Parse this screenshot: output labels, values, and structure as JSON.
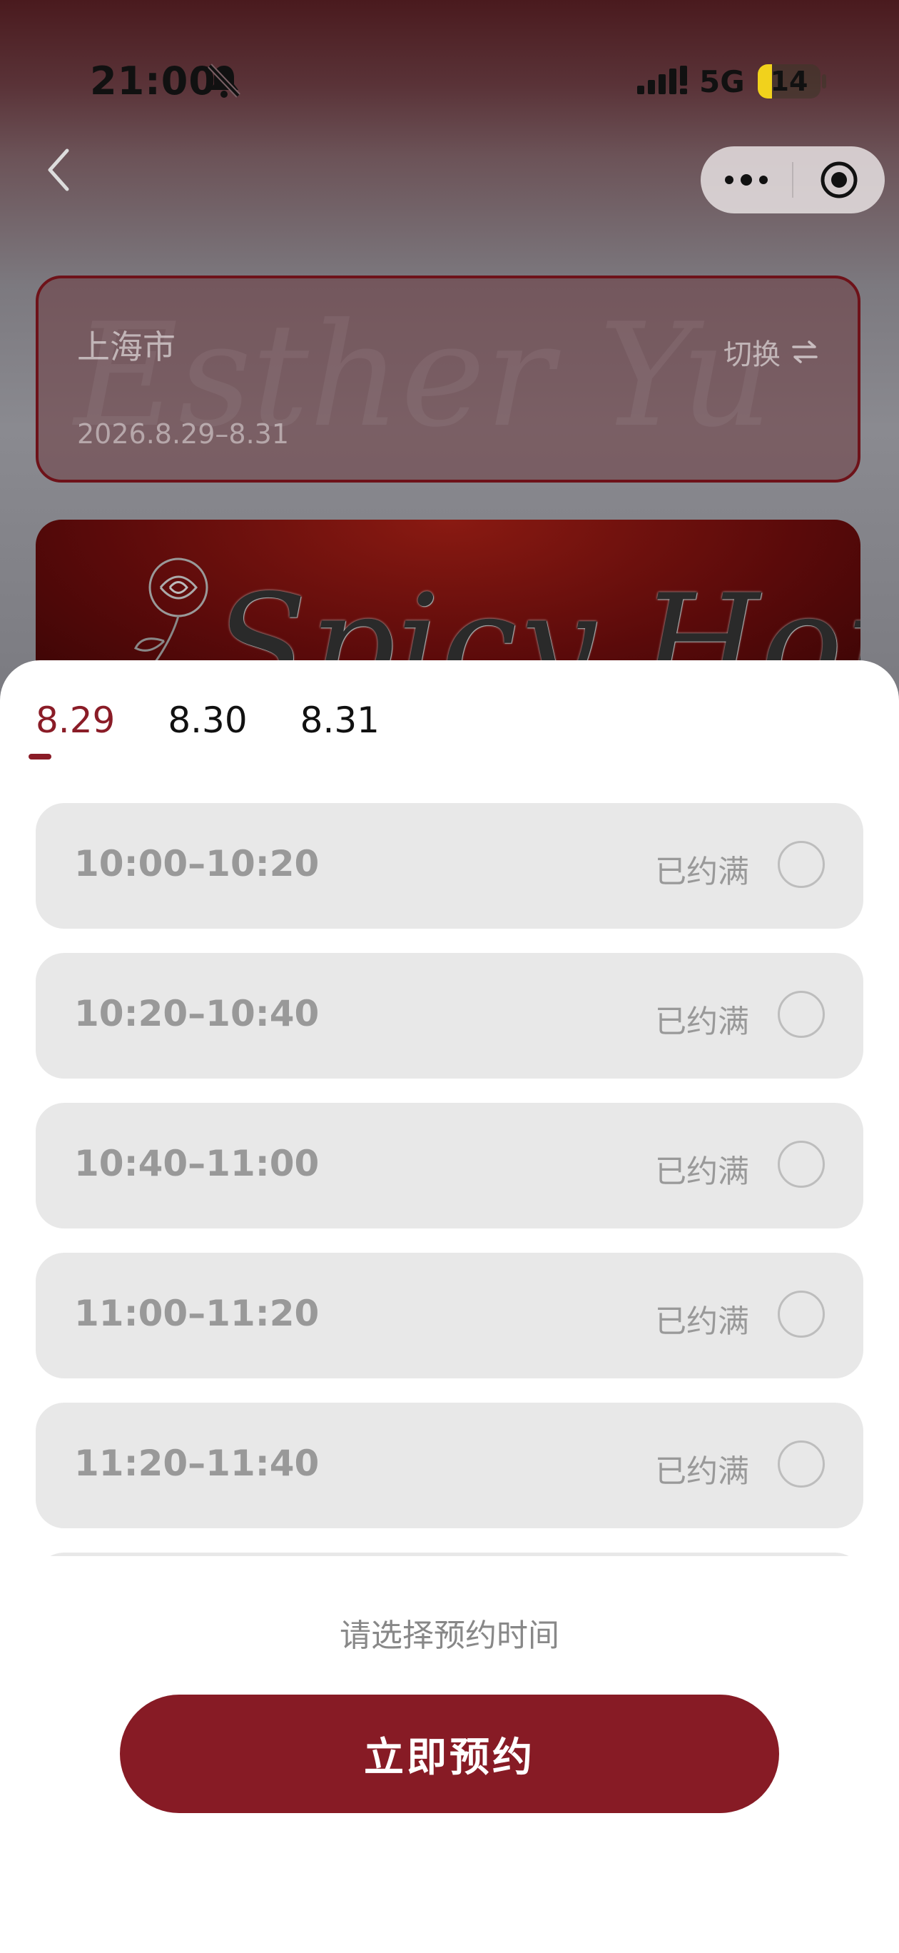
{
  "status_bar": {
    "time": "21:00",
    "network": "5G",
    "battery": "14"
  },
  "city_card": {
    "city": "上海市",
    "dates": "2026.8.29–8.31",
    "switch_label": "切换",
    "watermark_text": "Esther Yu"
  },
  "banner": {
    "title_art": "Spicy Honey"
  },
  "date_tabs": [
    {
      "label": "8.29",
      "active": true
    },
    {
      "label": "8.30",
      "active": false
    },
    {
      "label": "8.31",
      "active": false
    }
  ],
  "slots": [
    {
      "time": "10:00–10:20",
      "status": "已约满"
    },
    {
      "time": "10:20–10:40",
      "status": "已约满"
    },
    {
      "time": "10:40–11:00",
      "status": "已约满"
    },
    {
      "time": "11:00–11:20",
      "status": "已约满"
    },
    {
      "time": "11:20–11:40",
      "status": "已约满"
    }
  ],
  "hint": "请选择预约时间",
  "book_button": "立即预约",
  "colors": {
    "accent": "#871b25",
    "slot_bg": "#e8e8e8",
    "muted_text": "#999999"
  },
  "icons": [
    "bell-slash-icon",
    "signal-icon",
    "back-chevron-icon",
    "more-dots-icon",
    "target-icon",
    "swap-arrows-icon",
    "rose-icon"
  ]
}
